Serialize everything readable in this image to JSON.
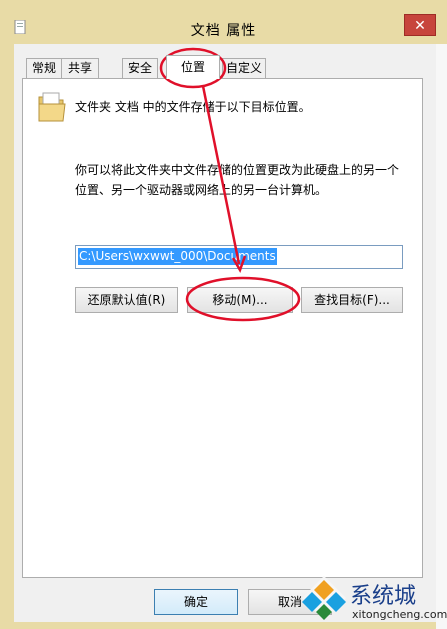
{
  "window": {
    "title": "文档 属性",
    "close_label": "✕"
  },
  "tabs": [
    {
      "label": "常规",
      "active": false
    },
    {
      "label": "共享",
      "active": false
    },
    {
      "label": "安全",
      "active": false
    },
    {
      "label": "位置",
      "active": true
    },
    {
      "label": "自定义",
      "active": false
    }
  ],
  "location": {
    "header_text": "文件夹 文档 中的文件存储于以下目标位置。",
    "description_line1": "你可以将此文件夹中文件存储的位置更改为此硬盘上的另一个",
    "description_line2": "位置、另一个驱动器或网络上的另一台计算机。",
    "path_value": "C:\\Users\\wxwwt_000\\Documents",
    "restore_button": "还原默认值(R)",
    "move_button": "移动(M)...",
    "find_target_button": "查找目标(F)..."
  },
  "footer": {
    "ok_button": "确定",
    "cancel_button": "取消"
  },
  "watermark": {
    "brand": "系统城",
    "url": "xitongcheng.com"
  },
  "colors": {
    "frame": "#e8dba6",
    "selection": "#3399ff",
    "annotation": "#e0102a",
    "close_button": "#c7443c"
  }
}
